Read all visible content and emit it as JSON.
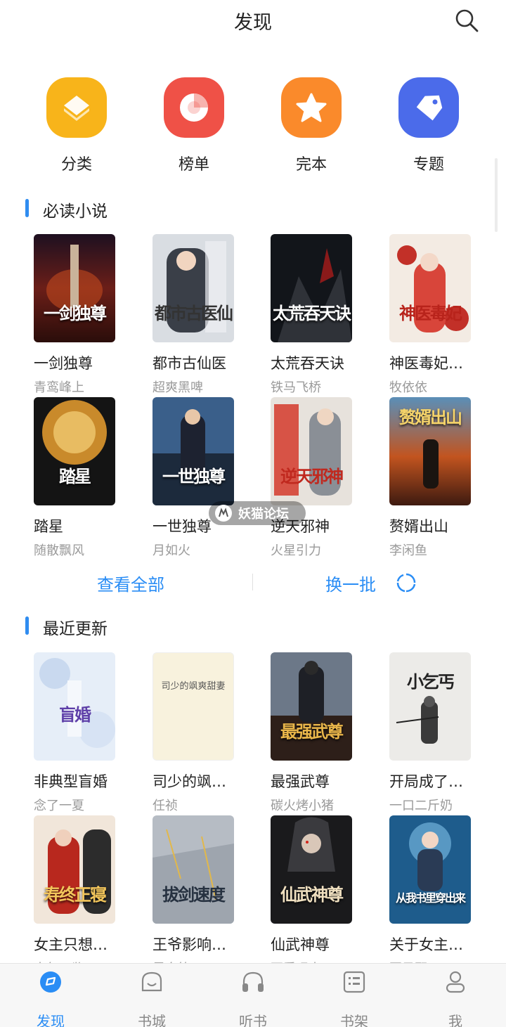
{
  "header": {
    "title": "发现"
  },
  "quick_nav": [
    {
      "label": "分类",
      "icon": "category-icon",
      "color": "#f8b41a"
    },
    {
      "label": "榜单",
      "icon": "ranking-icon",
      "color": "#ef5147"
    },
    {
      "label": "完本",
      "icon": "star-icon",
      "color": "#fa8a2b"
    },
    {
      "label": "专题",
      "icon": "tag-icon",
      "color": "#4b6bea"
    }
  ],
  "must_read": {
    "title": "必读小说",
    "books": [
      {
        "title": "一剑独尊",
        "author": "青鸾峰上",
        "cover_text": "一剑独尊"
      },
      {
        "title": "都市古仙医",
        "author": "超爽黑啤",
        "cover_text": "都市古医仙"
      },
      {
        "title": "太荒吞天诀",
        "author": "铁马飞桥",
        "cover_text": "太荒吞天诀"
      },
      {
        "title": "神医毒妃…",
        "author": "牧依依",
        "cover_text": "神医毒妃"
      },
      {
        "title": "踏星",
        "author": "随散飘风",
        "cover_text": "踏星"
      },
      {
        "title": "一世独尊",
        "author": "月如火",
        "cover_text": "一世独尊"
      },
      {
        "title": "逆天邪神",
        "author": "火星引力",
        "cover_text": "逆天邪神"
      },
      {
        "title": "赘婿出山",
        "author": "李闲鱼",
        "cover_text": "赘婿出山"
      }
    ],
    "view_all": "查看全部",
    "refresh": "换一批"
  },
  "recent": {
    "title": "最近更新",
    "books": [
      {
        "title": "非典型盲婚",
        "author": "念了一夏",
        "cover_text": "盲婚"
      },
      {
        "title": "司少的飒…",
        "author": "任祯",
        "cover_text": "司少的飒爽甜妻"
      },
      {
        "title": "最强武尊",
        "author": "碳火烤小猪",
        "cover_text": "最强武尊"
      },
      {
        "title": "开局成了…",
        "author": "一口二斤奶",
        "cover_text": "小乞丐"
      },
      {
        "title": "女主只想…",
        "author": "十年一鉴",
        "cover_text": "寿终正寝"
      },
      {
        "title": "王爷影响…",
        "author": "墨白筠",
        "cover_text": "拔剑速度"
      },
      {
        "title": "仙武神尊",
        "author": "不爱喝水",
        "cover_text": "仙武神尊"
      },
      {
        "title": "关于女主…",
        "author": "夏风野",
        "cover_text": "从我书里穿出来"
      }
    ]
  },
  "watermark": "妖猫论坛",
  "tabbar": [
    {
      "label": "发现",
      "icon": "discover-icon",
      "active": true
    },
    {
      "label": "书城",
      "icon": "bookstore-icon",
      "active": false
    },
    {
      "label": "听书",
      "icon": "headphones-icon",
      "active": false
    },
    {
      "label": "书架",
      "icon": "bookshelf-icon",
      "active": false
    },
    {
      "label": "我",
      "icon": "profile-icon",
      "active": false
    }
  ],
  "colors": {
    "accent": "#2a8df5",
    "section_bar": "#2f8cf0"
  }
}
